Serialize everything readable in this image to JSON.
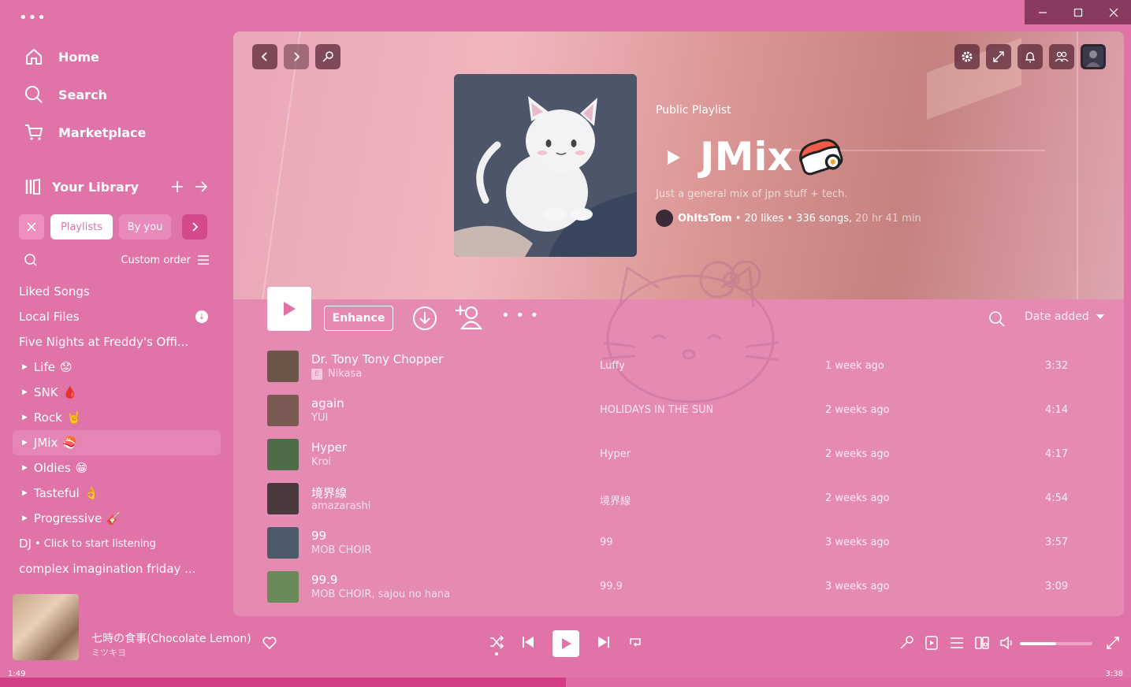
{
  "window": {
    "menu_icon": "more-dots-icon",
    "controls": [
      "minimize-icon",
      "maximize-icon",
      "close-icon"
    ]
  },
  "nav": {
    "home": "Home",
    "search": "Search",
    "marketplace": "Marketplace"
  },
  "library": {
    "title": "Your Library",
    "filters": {
      "playlists": "Playlists",
      "by_you": "By you"
    },
    "sort_label": "Custom order",
    "items": [
      {
        "label": "Liked Songs"
      },
      {
        "label": "Local Files"
      },
      {
        "label": "Five Nights at Freddy's Offi..."
      },
      {
        "label": "Life",
        "emoji": "😟"
      },
      {
        "label": "SNK",
        "emoji": "🩸"
      },
      {
        "label": "Rock",
        "emoji": "🤘"
      },
      {
        "label": "JMix",
        "emoji": "🍣"
      },
      {
        "label": "Oldies",
        "emoji": "😁"
      },
      {
        "label": "Tasteful",
        "emoji": "👌"
      },
      {
        "label": "Progressive",
        "emoji": "🎸"
      },
      {
        "label": "DJ",
        "sub": "• Click to start listening"
      },
      {
        "label": "complex imagination friday ..."
      }
    ]
  },
  "playlist": {
    "type": "Public Playlist",
    "title": "JMix",
    "description": "Just a general mix of jpn stuff + tech.",
    "owner": "OhItsTom",
    "likes": "• 20 likes •",
    "songs": "336 songs,",
    "duration": "20 hr 41 min"
  },
  "actions": {
    "enhance": "Enhance",
    "sort": "Date added"
  },
  "tracks": [
    {
      "title": "Dr. Tony Tony Chopper",
      "artist": "Nikasa",
      "explicit": true,
      "album": "Luffy",
      "added": "1 week ago",
      "duration": "3:32",
      "color": "#6b5648"
    },
    {
      "title": "again",
      "artist": "YUI",
      "explicit": false,
      "album": "HOLIDAYS IN THE SUN",
      "added": "2 weeks ago",
      "duration": "4:14",
      "color": "#7a5a52"
    },
    {
      "title": "Hyper",
      "artist": "Kroi",
      "explicit": false,
      "album": "Hyper",
      "added": "2 weeks ago",
      "duration": "4:17",
      "color": "#4f6b48"
    },
    {
      "title": "境界線",
      "artist": "amazarashi",
      "explicit": false,
      "album": "境界線",
      "added": "2 weeks ago",
      "duration": "4:54",
      "color": "#4a3a3d"
    },
    {
      "title": "99",
      "artist": "MOB CHOIR",
      "explicit": false,
      "album": "99",
      "added": "3 weeks ago",
      "duration": "3:57",
      "color": "#4c5a6a"
    },
    {
      "title": "99.9",
      "artist": "MOB CHOIR, sajou no hana",
      "explicit": false,
      "album": "99.9",
      "added": "3 weeks ago",
      "duration": "3:09",
      "color": "#6a8a5a"
    }
  ],
  "now_playing": {
    "title": "七時の食事(Chocolate Lemon)",
    "artist": "ミツキヨ",
    "elapsed": "1:49",
    "total": "3:38",
    "progress": 0.5,
    "volume": 0.5
  },
  "colors": {
    "accent": "#e073a8",
    "dark_accent": "#d23d86",
    "window_bar": "#8a3a61"
  }
}
